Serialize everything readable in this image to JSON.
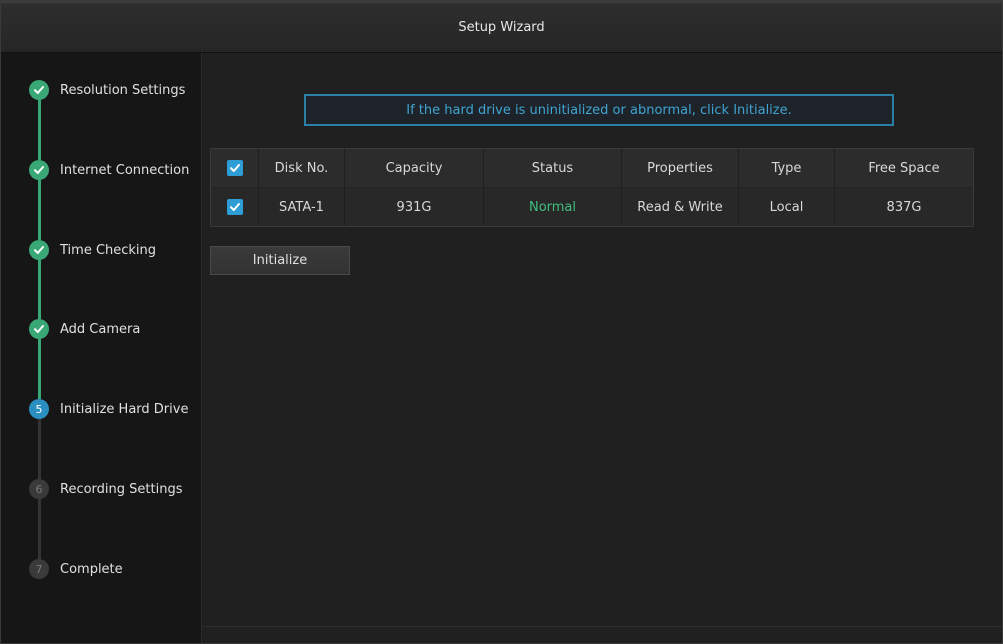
{
  "window": {
    "title": "Setup Wizard"
  },
  "steps": [
    {
      "label": "Resolution Settings",
      "state": "done",
      "number": "1"
    },
    {
      "label": "Internet Connection",
      "state": "done",
      "number": "2"
    },
    {
      "label": "Time Checking",
      "state": "done",
      "number": "3"
    },
    {
      "label": "Add Camera",
      "state": "done",
      "number": "4"
    },
    {
      "label": "Initialize Hard Drive",
      "state": "active",
      "number": "5"
    },
    {
      "label": "Recording Settings",
      "state": "pending",
      "number": "6"
    },
    {
      "label": "Complete",
      "state": "pending",
      "number": "7"
    }
  ],
  "hint": {
    "text": "If the hard drive is uninitialized or abnormal, click Initialize."
  },
  "table": {
    "headers": [
      "Disk No.",
      "Capacity",
      "Status",
      "Properties",
      "Type",
      "Free Space"
    ],
    "header_checked": true,
    "rows": [
      {
        "checked": true,
        "disk_no": "SATA-1",
        "capacity": "931G",
        "status": "Normal",
        "properties": "Read & Write",
        "type": "Local",
        "free_space": "837G"
      }
    ]
  },
  "actions": {
    "initialize_label": "Initialize"
  },
  "colors": {
    "done": "#3aa876",
    "active": "#2a8fc0",
    "accent": "#2e9dd6",
    "status_normal": "#3fbf7f"
  },
  "icons": {
    "done": "checkmark-icon",
    "checkbox": "checkbox-checked-icon"
  }
}
